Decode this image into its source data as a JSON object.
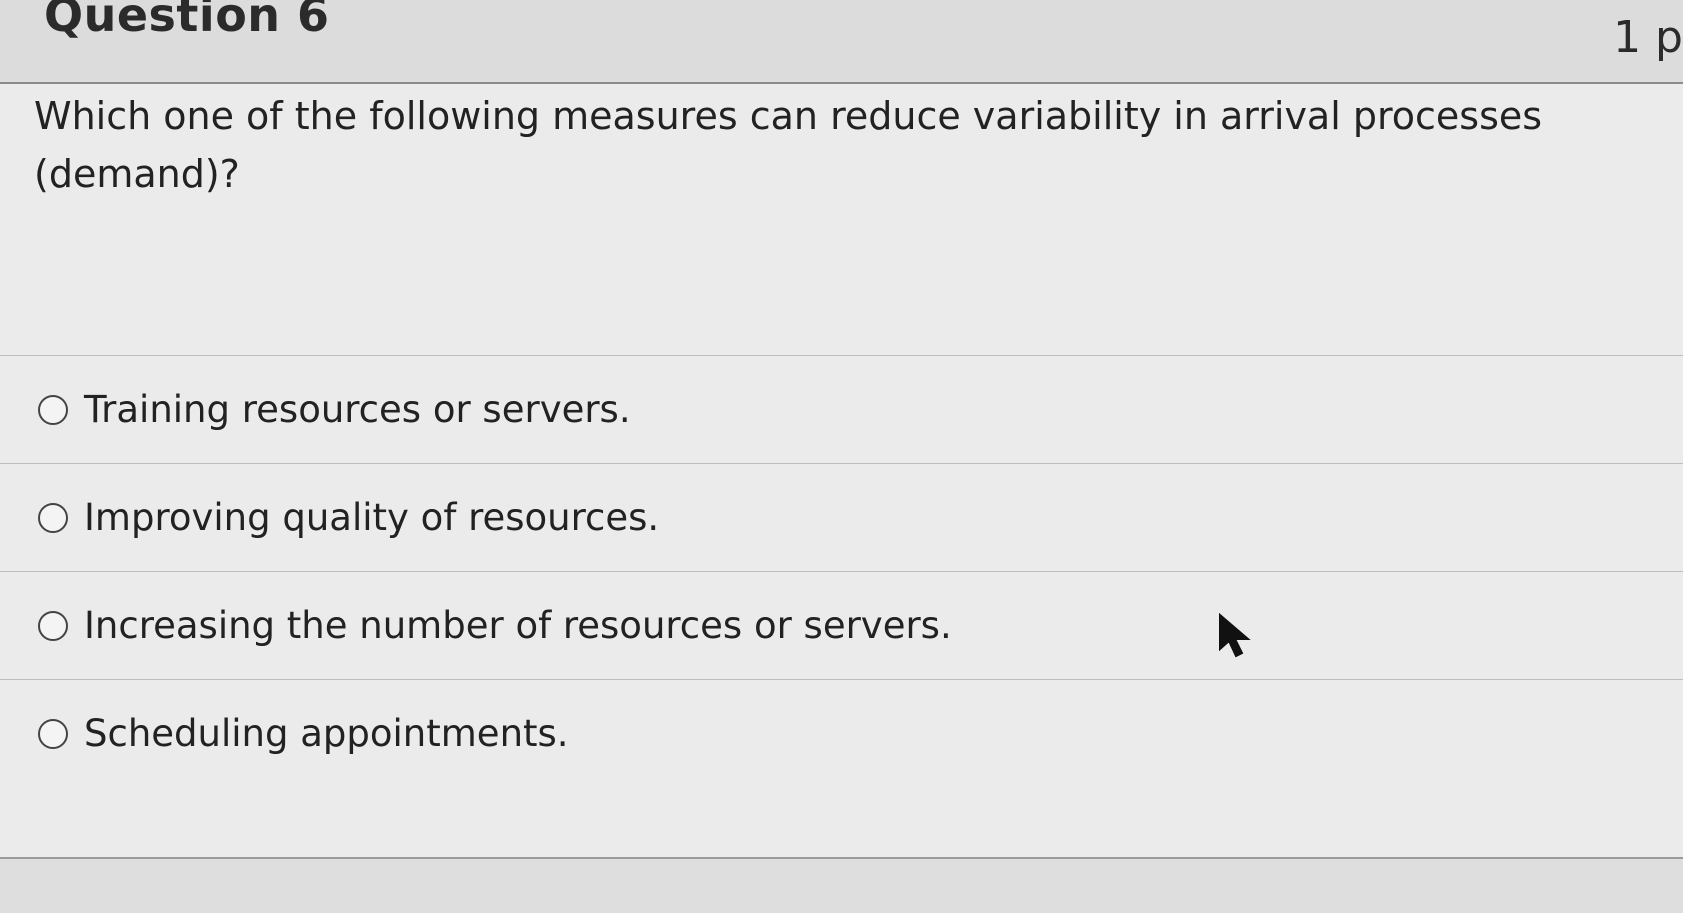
{
  "header": {
    "question_title": "Question 6",
    "points": "1 p"
  },
  "question": {
    "text": "Which one of the following measures can reduce variability in arrival processes (demand)?"
  },
  "answers": [
    {
      "label": "Training resources or servers.",
      "selected": false
    },
    {
      "label": "Improving quality of resources.",
      "selected": false
    },
    {
      "label": "Increasing the number of resources or servers.",
      "selected": false
    },
    {
      "label": "Scheduling appointments.",
      "selected": false
    }
  ],
  "icons": {
    "radio": "radio-unselected-icon",
    "cursor": "mouse-pointer-icon"
  }
}
